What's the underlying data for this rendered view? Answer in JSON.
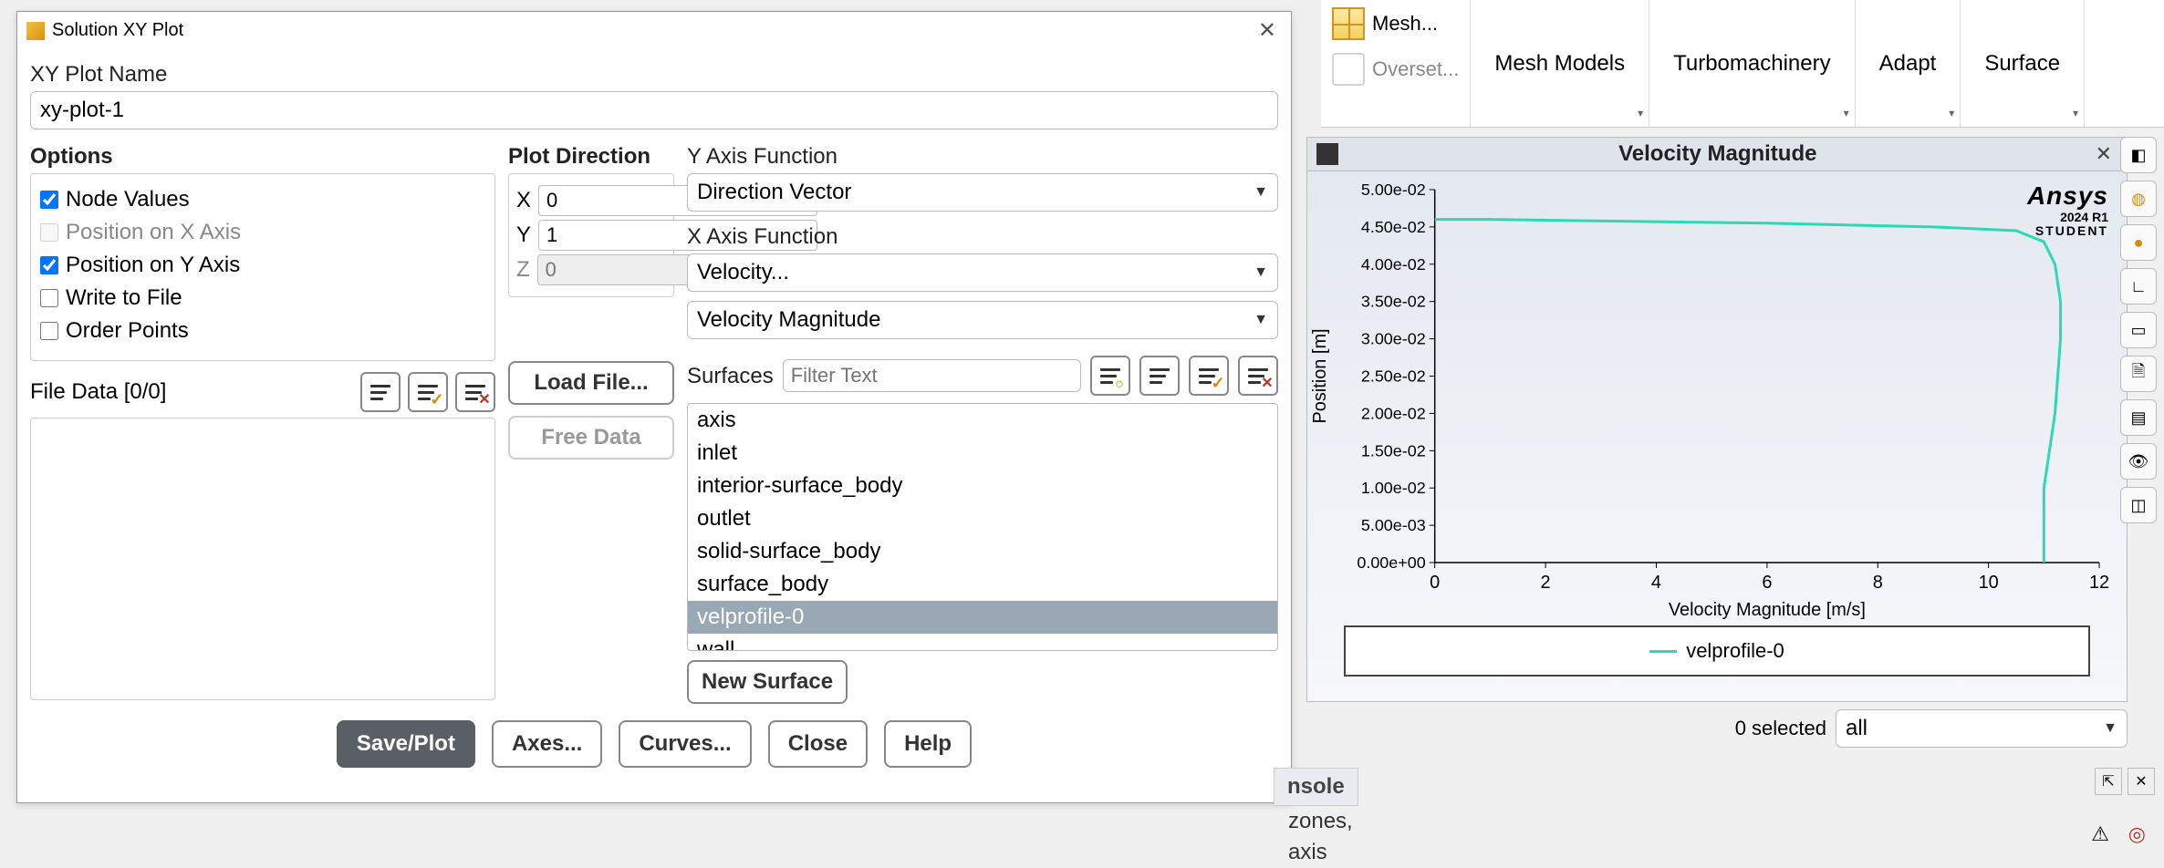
{
  "ribbon": {
    "mesh_label": "Mesh...",
    "overset_label": "Overset...",
    "mesh_models": "Mesh Models",
    "turbomachinery": "Turbomachinery",
    "adapt": "Adapt",
    "surface": "Surface"
  },
  "dialog": {
    "title": "Solution XY Plot",
    "name_label": "XY Plot Name",
    "name_value": "xy-plot-1",
    "options_label": "Options",
    "opt_node_values": "Node Values",
    "opt_pos_x": "Position on X Axis",
    "opt_pos_y": "Position on Y Axis",
    "opt_write": "Write to File",
    "opt_order": "Order Points",
    "plot_dir_label": "Plot Direction",
    "pd_x": "X",
    "pd_x_val": "0",
    "pd_y": "Y",
    "pd_y_val": "1",
    "pd_z": "Z",
    "pd_z_val": "0",
    "yfunc_label": "Y Axis Function",
    "yfunc_value": "Direction Vector",
    "xfunc_label": "X Axis Function",
    "xfunc_value1": "Velocity...",
    "xfunc_value2": "Velocity Magnitude",
    "surfaces_label": "Surfaces",
    "filter_placeholder": "Filter Text",
    "surfaces": [
      "axis",
      "inlet",
      "interior-surface_body",
      "outlet",
      "solid-surface_body",
      "surface_body",
      "velprofile-0",
      "wall"
    ],
    "selected_surface_index": 6,
    "new_surface_btn": "New Surface",
    "file_data_label": "File Data [0/0]",
    "load_file_btn": "Load File...",
    "free_data_btn": "Free Data",
    "save_plot_btn": "Save/Plot",
    "axes_btn": "Axes...",
    "curves_btn": "Curves...",
    "close_btn": "Close",
    "help_btn": "Help"
  },
  "chart": {
    "title": "Velocity Magnitude",
    "brand_name": "Ansys",
    "brand_ver": "2024 R1",
    "brand_ed": "STUDENT",
    "legend_item": "velprofile-0",
    "xlabel": "Velocity Magnitude [m/s]",
    "ylabel": "Position [m]"
  },
  "chart_data": {
    "type": "line",
    "title": "Velocity Magnitude",
    "xlabel": "Velocity Magnitude [m/s]",
    "ylabel": "Position [m]",
    "xlim": [
      0,
      12
    ],
    "ylim": [
      0,
      0.05
    ],
    "xticks": [
      0,
      2,
      4,
      6,
      8,
      10,
      12
    ],
    "yticks_labels": [
      "0.00e+00",
      "5.00e-03",
      "1.00e-02",
      "1.50e-02",
      "2.00e-02",
      "2.50e-02",
      "3.00e-02",
      "3.50e-02",
      "4.00e-02",
      "4.50e-02",
      "5.00e-02"
    ],
    "series": [
      {
        "name": "velprofile-0",
        "color": "#2dd9b5",
        "x": [
          0.0,
          1.0,
          3.0,
          6.0,
          9.0,
          10.5,
          11.0,
          11.2,
          11.3,
          11.3,
          11.25,
          11.2,
          11.1,
          11.0,
          11.0
        ],
        "y": [
          0.046,
          0.046,
          0.0458,
          0.0455,
          0.045,
          0.0445,
          0.043,
          0.04,
          0.035,
          0.03,
          0.025,
          0.02,
          0.015,
          0.01,
          0.0
        ]
      }
    ]
  },
  "selection": {
    "label": "0 selected",
    "dropdown": "all"
  },
  "console": {
    "tab": "nsole",
    "line1": "zones,",
    "line2": "axis"
  }
}
